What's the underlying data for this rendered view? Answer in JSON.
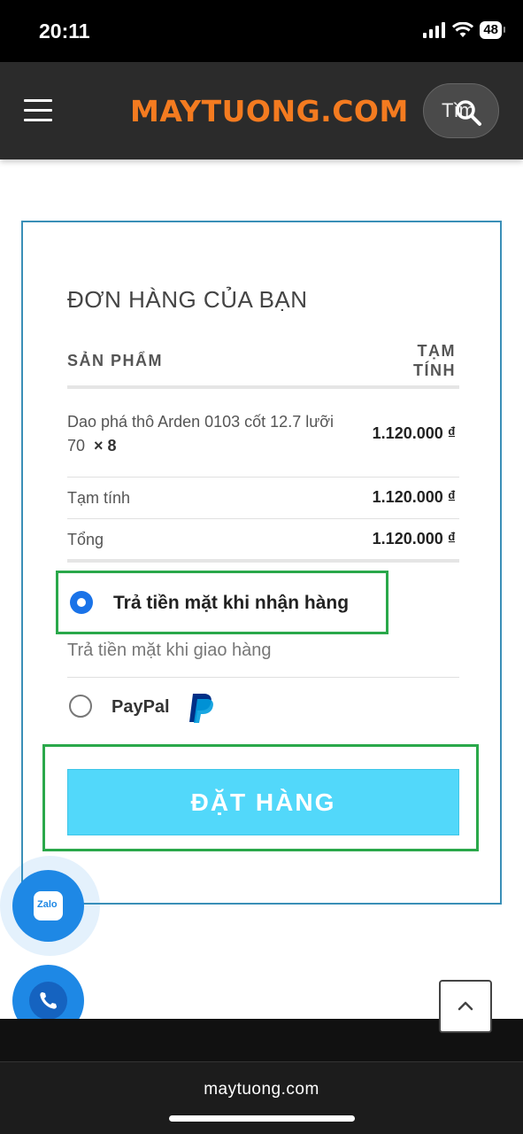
{
  "status": {
    "time": "20:11",
    "battery": "48"
  },
  "header": {
    "logo": "MAYTUONG.COM",
    "search_text": "Tìm"
  },
  "order": {
    "title": "ĐƠN HÀNG CỦA BẠN",
    "col_product": "SẢN PHẨM",
    "col_subtotal_line1": "TẠM",
    "col_subtotal_line2": "TÍNH",
    "product_name": "Dao phá thô Arden 0103 cốt 12.7 lưỡi 70",
    "product_qty": "× 8",
    "product_amount": "1.120.000 ₫",
    "subtotal_label": "Tạm tính",
    "subtotal_amount": "1.120.000 ₫",
    "total_label": "Tổng",
    "total_amount": "1.120.000 ₫"
  },
  "payment": {
    "cod_label": "Trả tiền mặt khi nhận hàng",
    "cod_desc": "Trả tiền mặt khi giao hàng",
    "paypal_label": "PayPal",
    "selected": "cod"
  },
  "place_order_label": "ĐẶT HÀNG",
  "zalo_label": "Zalo",
  "browser": {
    "url": "maytuong.com"
  },
  "colors": {
    "brand": "#f47b20",
    "accent": "#52d8fa",
    "highlight_border": "#2aa84a",
    "box_border": "#3a8fb7"
  }
}
